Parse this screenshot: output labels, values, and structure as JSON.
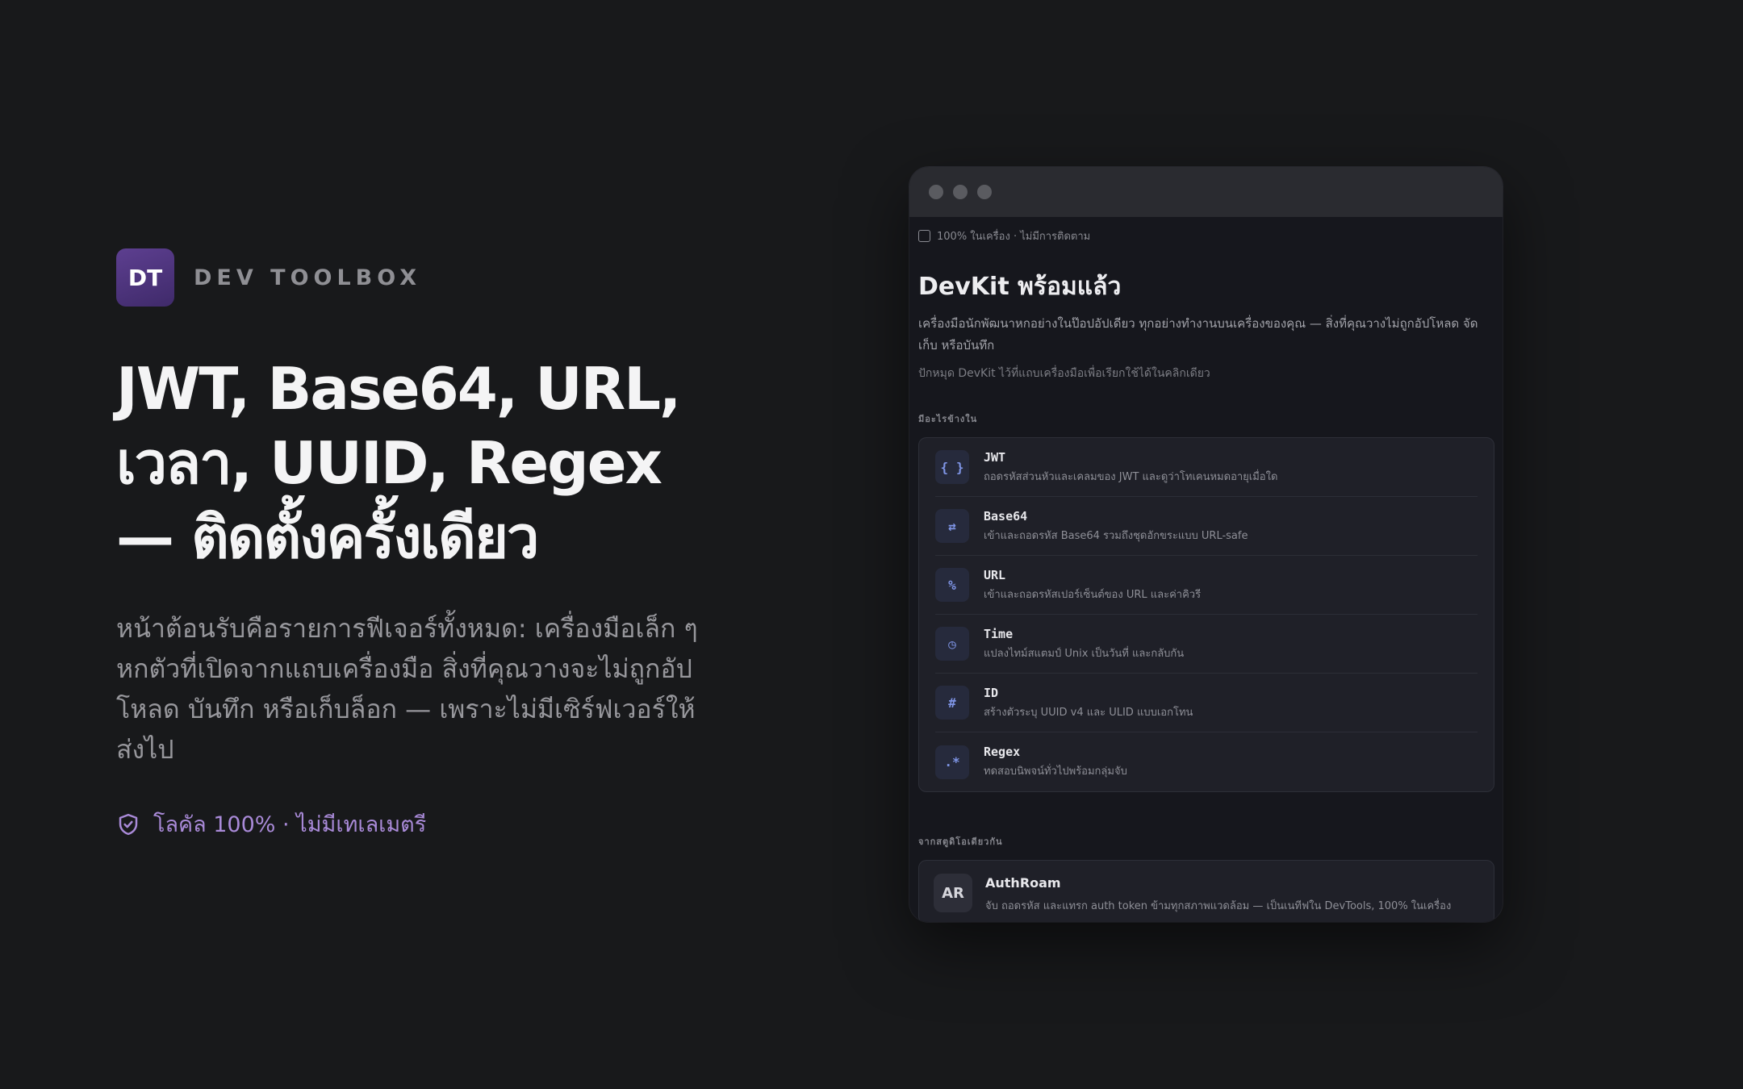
{
  "brand": {
    "logo": "DT",
    "name": "DEV TOOLBOX",
    "logo_color": "#4f3580"
  },
  "headline": {
    "line1": "JWT, Base64, URL,",
    "line2": "เวลา, UUID, Regex",
    "line3": "— ติดตั้งครั้งเดียว"
  },
  "subtext": "หน้าต้อนรับคือรายการฟีเจอร์ทั้งหมด: เครื่องมือเล็ก ๆ หกตัวที่เปิดจากแถบเครื่องมือ สิ่งที่คุณวางจะไม่ถูกอัปโหลด บันทึก หรือเก็บล็อก — เพราะไม่มีเซิร์ฟเวอร์ให้ส่งไป",
  "badge": {
    "icon": "shield-check-icon",
    "text": "โลคัล 100% · ไม่มีเทเลเมตรี",
    "color": "#a98ad8"
  },
  "window": {
    "status": "100% ในเครื่อง · ไม่มีการติดตาม",
    "title": "DevKit พร้อมแล้ว",
    "description": "เครื่องมือนักพัฒนาหกอย่างในป๊อปอัปเดียว ทุกอย่างทำงานบนเครื่องของคุณ — สิ่งที่คุณวางไม่ถูกอัปโหลด จัดเก็บ หรือบันทึก",
    "hint": "ปักหมุด DevKit ไว้ที่แถบเครื่องมือเพื่อเรียกใช้ได้ในคลิกเดียว",
    "section_tools": "มีอะไรข้างใน",
    "tools": [
      {
        "icon": "{ }",
        "name": "JWT",
        "desc": "ถอดรหัสส่วนหัวและเคลมของ JWT และดูว่าโทเคนหมดอายุเมื่อใด"
      },
      {
        "icon": "⇄",
        "name": "Base64",
        "desc": "เข้าและถอดรหัส Base64 รวมถึงชุดอักขระแบบ URL-safe"
      },
      {
        "icon": "%",
        "name": "URL",
        "desc": "เข้าและถอดรหัสเปอร์เซ็นต์ของ URL และค่าคิวรี"
      },
      {
        "icon": "◷",
        "name": "Time",
        "desc": "แปลงไทม์สแตมป์ Unix เป็นวันที่ และกลับกัน"
      },
      {
        "icon": "#",
        "name": "ID",
        "desc": "สร้างตัวระบุ UUID v4 และ ULID แบบเอกโทน"
      },
      {
        "icon": ".*",
        "name": "Regex",
        "desc": "ทดสอบนิพจน์ทั่วไปพร้อมกลุ่มจับ"
      }
    ],
    "section_other": "จากสตูดิโอเดียวกัน",
    "other": {
      "avatar": "AR",
      "name": "AuthRoam",
      "desc": "จับ ถอดรหัส และแทรก auth token ข้ามทุกสภาพแวดล้อม — เป็นเนทีฟใน DevTools, 100% ในเครื่อง"
    }
  }
}
